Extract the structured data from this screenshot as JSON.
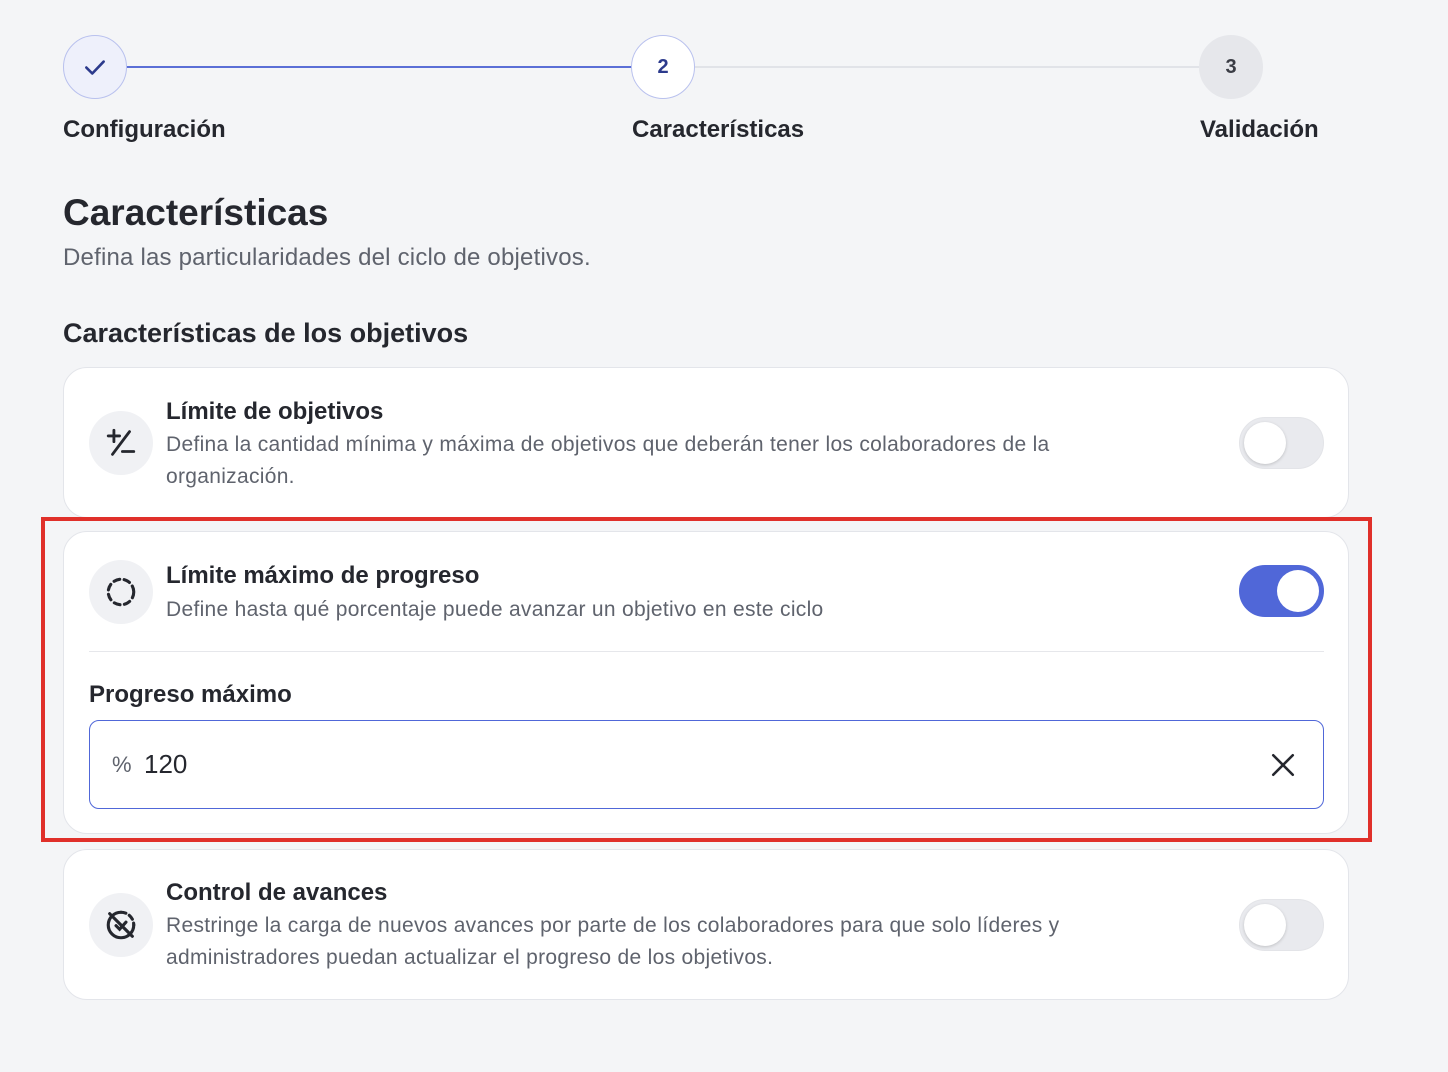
{
  "stepper": {
    "steps": [
      {
        "number": "",
        "label": "Configuración",
        "state": "completed",
        "icon": "check-icon"
      },
      {
        "number": "2",
        "label": "Características",
        "state": "active"
      },
      {
        "number": "3",
        "label": "Validación",
        "state": "pending"
      }
    ]
  },
  "header": {
    "title": "Características",
    "subtitle": "Defina las particularidades del ciclo de objetivos."
  },
  "section": {
    "title": "Características de los objetivos"
  },
  "cards": [
    {
      "icon": "plus-minus-icon",
      "title": "Límite de objetivos",
      "description": "Defina la cantidad mínima y máxima de objetivos que deberán tener los colaboradores de la organización.",
      "enabled": false
    },
    {
      "icon": "dashed-circle-icon",
      "title": "Límite máximo de progreso",
      "description": "Define hasta qué porcentaje puede avanzar un objetivo en este ciclo",
      "enabled": true,
      "field": {
        "label": "Progreso máximo",
        "prefix": "%",
        "value": "120",
        "clear_icon": "close-icon"
      }
    },
    {
      "icon": "progress-off-icon",
      "title": "Control de avances",
      "description": "Restringe la carga de nuevos avances por parte de los colaboradores para que solo líderes y administradores puedan actualizar el progreso de los objetivos.",
      "enabled": false
    }
  ],
  "colors": {
    "accent": "#5067d8",
    "highlight": "#e0302a",
    "background": "#f4f5f7"
  }
}
